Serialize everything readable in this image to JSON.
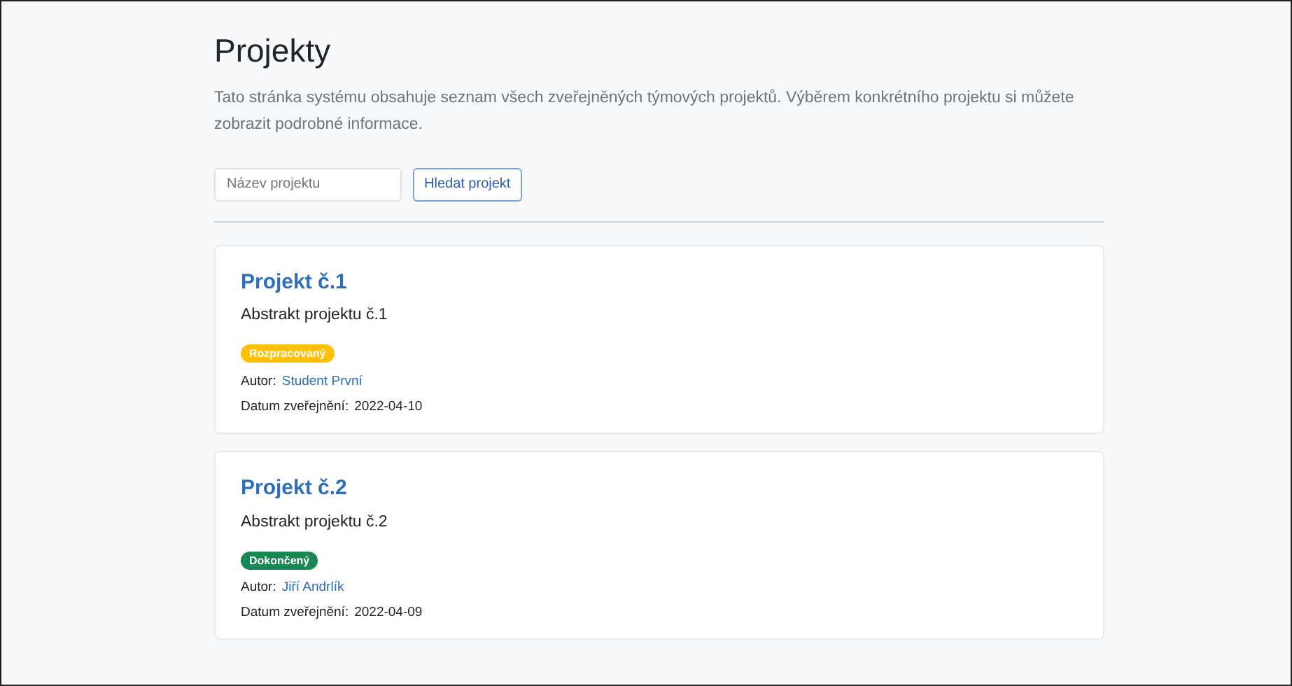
{
  "page": {
    "title": "Projekty",
    "description": "Tato stránka systému obsahuje seznam všech zveřejněných týmových projektů. Výběrem konkrétního projektu si můžete zobrazit podrobné informace."
  },
  "search": {
    "placeholder": "Název projektu",
    "button": "Hledat projekt"
  },
  "projects": [
    {
      "title": "Projekt č.1",
      "abstract": "Abstrakt projektu č.1",
      "status": "Rozpracovaný",
      "color": "#ffc107",
      "author_label": "Autor:",
      "author": "Student První",
      "date_label": "Datum zveřejnění:",
      "date": "2022-04-10"
    },
    {
      "title": "Projekt č.2",
      "abstract": "Abstrakt projektu č.2",
      "status": "Dokončený",
      "color": "#198754",
      "author_label": "Autor:",
      "author": "Jiří Andrlík",
      "date_label": "Datum zveřejnění:",
      "date": "2022-04-09"
    }
  ]
}
